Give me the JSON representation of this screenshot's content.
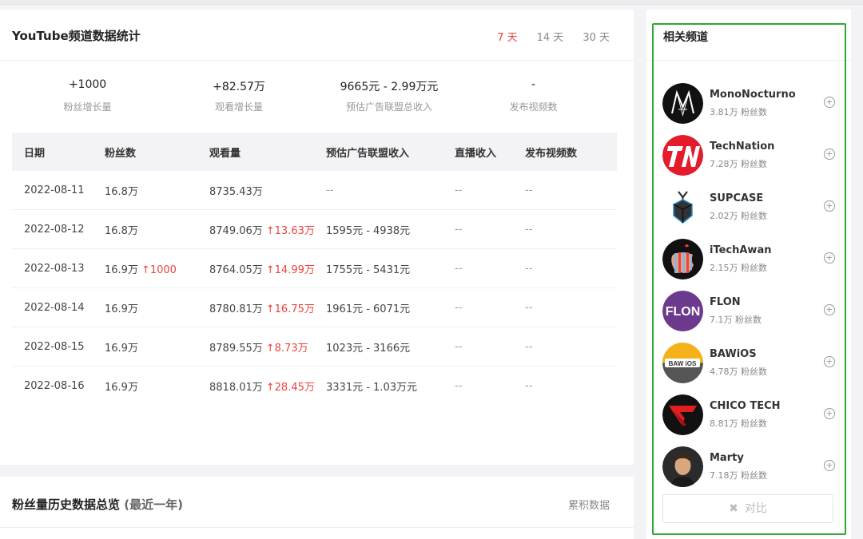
{
  "main": {
    "title": "YouTube频道数据统计",
    "ranges": [
      "7 天",
      "14 天",
      "30 天"
    ],
    "active_range": "7 天",
    "stats": [
      {
        "value": "+1000",
        "label": "粉丝增长量"
      },
      {
        "value": "+82.57万",
        "label": "观看增长量"
      },
      {
        "value": "9665元 - 2.99万元",
        "label": "预估广告联盟总收入"
      },
      {
        "value": "-",
        "label": "发布视频数"
      }
    ],
    "table": {
      "headers": [
        "日期",
        "粉丝数",
        "观看量",
        "预估广告联盟收入",
        "直播收入",
        "发布视频数"
      ],
      "rows": [
        {
          "date": "2022-08-11",
          "subs": "16.8万",
          "subs_inc": "",
          "views": "8735.43万",
          "views_inc": "",
          "ad": "--",
          "live": "--",
          "videos": "--"
        },
        {
          "date": "2022-08-12",
          "subs": "16.8万",
          "subs_inc": "",
          "views": "8749.06万",
          "views_inc": "↑13.63万",
          "ad": "1595元 - 4938元",
          "live": "--",
          "videos": "--"
        },
        {
          "date": "2022-08-13",
          "subs": "16.9万",
          "subs_inc": "↑1000",
          "views": "8764.05万",
          "views_inc": "↑14.99万",
          "ad": "1755元 - 5431元",
          "live": "--",
          "videos": "--"
        },
        {
          "date": "2022-08-14",
          "subs": "16.9万",
          "subs_inc": "",
          "views": "8780.81万",
          "views_inc": "↑16.75万",
          "ad": "1961元 - 6071元",
          "live": "--",
          "videos": "--"
        },
        {
          "date": "2022-08-15",
          "subs": "16.9万",
          "subs_inc": "",
          "views": "8789.55万",
          "views_inc": "↑8.73万",
          "ad": "1023元 - 3166元",
          "live": "--",
          "videos": "--"
        },
        {
          "date": "2022-08-16",
          "subs": "16.9万",
          "subs_inc": "",
          "views": "8818.01万",
          "views_inc": "↑28.45万",
          "ad": "3331元 - 1.03万元",
          "live": "--",
          "videos": "--"
        }
      ]
    }
  },
  "history": {
    "title": "粉丝量历史数据总览",
    "subtitle": "(最近一年)",
    "cumulative_label": "累积数据"
  },
  "sidebar": {
    "title": "相关频道",
    "channels": [
      {
        "name": "MonoNocturno",
        "subs": "3.81万 粉丝数",
        "icon": "mononocturno-avatar"
      },
      {
        "name": "TechNation",
        "subs": "7.28万 粉丝数",
        "icon": "technation-avatar"
      },
      {
        "name": "SUPCASE",
        "subs": "2.02万 粉丝数",
        "icon": "supcase-avatar"
      },
      {
        "name": "iTechAwan",
        "subs": "2.15万 粉丝数",
        "icon": "itechawan-avatar"
      },
      {
        "name": "FLON",
        "subs": "7.1万 粉丝数",
        "icon": "flon-avatar",
        "logo_text": "FLON"
      },
      {
        "name": "BAWiOS",
        "subs": "4.78万 粉丝数",
        "icon": "bawios-avatar",
        "logo_text": "BAW iOS"
      },
      {
        "name": "CHICO TECH",
        "subs": "8.81万 粉丝数",
        "icon": "chicotech-avatar"
      },
      {
        "name": "Marty",
        "subs": "7.18万 粉丝数",
        "icon": "marty-avatar"
      }
    ],
    "compare_label": "对比",
    "compare_icon": "✖"
  },
  "colors": {
    "accent": "#e8453c",
    "highlight_frame": "#2ea832"
  }
}
